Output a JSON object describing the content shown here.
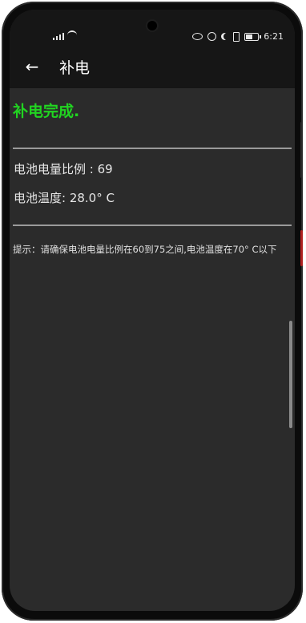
{
  "status": {
    "time": "6:21"
  },
  "toolbar": {
    "back_icon": "arrow-left-icon",
    "title": "补电"
  },
  "main": {
    "status_text": "补电完成.",
    "battery_level": "电池电量比例 : 69",
    "battery_temp": "电池温度: 28.0° C",
    "tip": "提示：请确保电池电量比例在60到75之间,电池温度在70° C以下"
  },
  "colors": {
    "success": "#21d421",
    "background": "#2b2b2b",
    "bar": "#161616"
  }
}
